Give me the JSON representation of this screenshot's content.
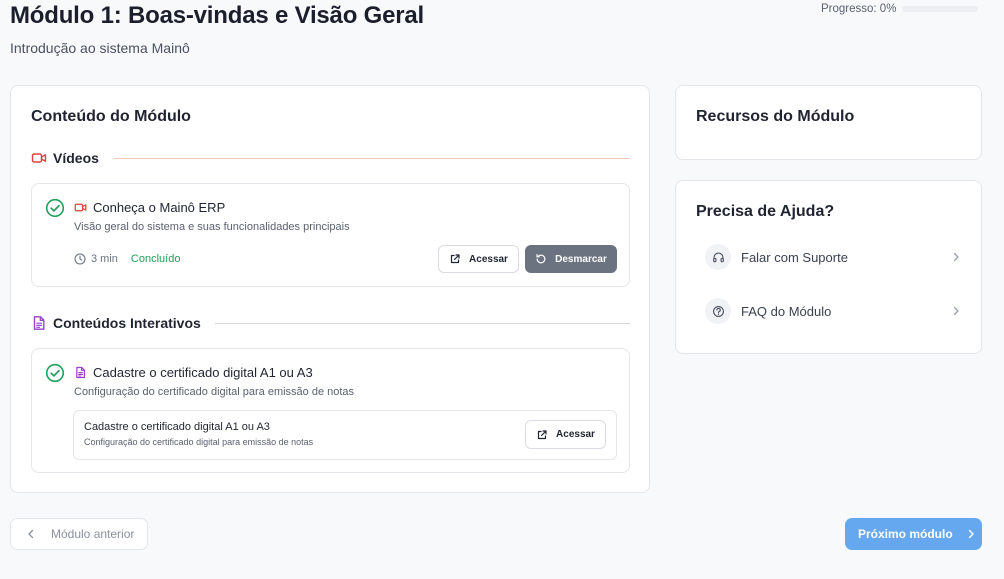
{
  "header": {
    "title": "Módulo 1: Boas-vindas e Visão Geral",
    "subtitle": "Introdução ao sistema Mainô",
    "progress_label": "Progresso: 0%",
    "progress_value": 0
  },
  "content": {
    "title": "Conteúdo do Módulo",
    "sections": [
      {
        "label": "Vídeos",
        "icon": "video-icon",
        "color": "#e0413a",
        "items": [
          {
            "title": "Conheça o Mainô ERP",
            "description": "Visão geral do sistema e suas funcionalidades principais",
            "duration": "3 min",
            "status": "Concluído",
            "access_label": "Acessar",
            "unmark_label": "Desmarcar"
          }
        ]
      },
      {
        "label": "Conteúdos Interativos",
        "icon": "document-icon",
        "color": "#9b3fd1",
        "items": [
          {
            "title": "Cadastre o certificado digital A1 ou A3",
            "description": "Configuração do certificado digital para emissão de notas",
            "embed": {
              "title": "Cadastre o certificado digital A1 ou A3",
              "description": "Configuração do certificado digital para emissão de notas",
              "access_label": "Acessar"
            }
          }
        ]
      }
    ]
  },
  "resources": {
    "title": "Recursos do Módulo"
  },
  "help": {
    "title": "Precisa de Ajuda?",
    "items": [
      {
        "label": "Falar com Suporte",
        "icon": "headphones-icon"
      },
      {
        "label": "FAQ do Módulo",
        "icon": "question-circle-icon"
      }
    ]
  },
  "navigation": {
    "prev_label": "Módulo anterior",
    "next_label": "Próximo módulo"
  },
  "colors": {
    "accent": "#66a8f0",
    "success": "#22a05a",
    "video": "#e0413a",
    "interactive": "#9b3fd1",
    "dark_button": "#6b7280"
  }
}
